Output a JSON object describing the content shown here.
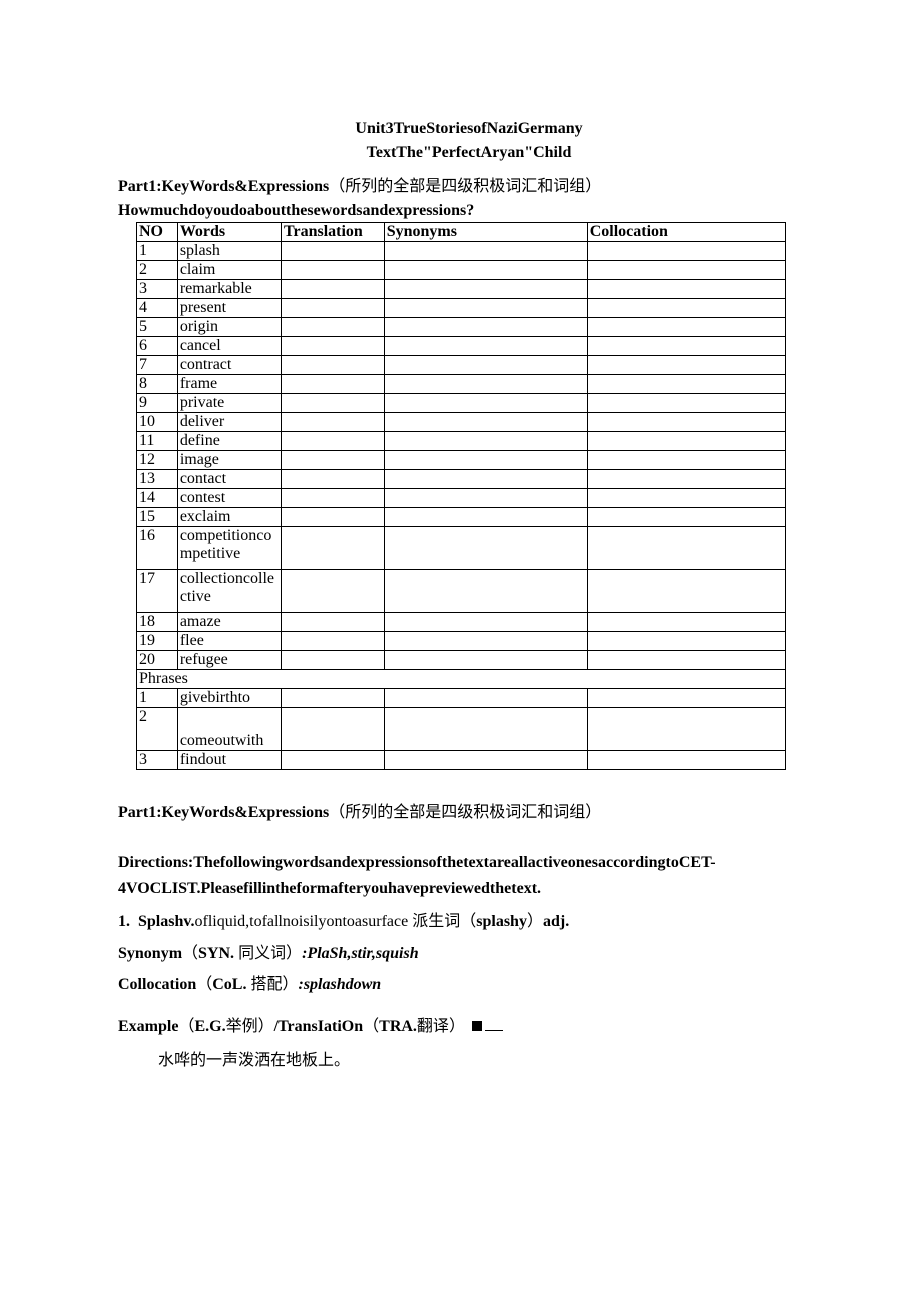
{
  "title_line1": "Unit3TrueStoriesofNaziGermany",
  "title_line2": "TextThe\"PerfectAryan\"Child",
  "part1_heading_bold": "Part1:KeyWords&Expressions",
  "part1_heading_note": "（所列的全部是四级积极词汇和词组）",
  "question": "Howmuchdoyoudoaboutthesewordsandexpressions?",
  "headers": {
    "no": "NO",
    "words": "Words",
    "translation": "Translation",
    "synonyms": "Synonyms",
    "collocation": "Collocation"
  },
  "rows": [
    {
      "no": "1",
      "word": "splash"
    },
    {
      "no": "2",
      "word": "claim"
    },
    {
      "no": "3",
      "word": "remarkable"
    },
    {
      "no": "4",
      "word": "present"
    },
    {
      "no": "5",
      "word": "origin"
    },
    {
      "no": "6",
      "word": "cancel"
    },
    {
      "no": "7",
      "word": "contract"
    },
    {
      "no": "8",
      "word": "frame"
    },
    {
      "no": "9",
      "word": "private"
    },
    {
      "no": "10",
      "word": "deliver"
    },
    {
      "no": "11",
      "word": "define"
    },
    {
      "no": "12",
      "word": "image"
    },
    {
      "no": "13",
      "word": "contact"
    },
    {
      "no": "14",
      "word": "contest"
    },
    {
      "no": "15",
      "word": "exclaim"
    },
    {
      "no": "16",
      "word": "competitioncompetitive"
    },
    {
      "no": "17",
      "word": "collectioncollective"
    },
    {
      "no": "18",
      "word": "amaze"
    },
    {
      "no": "19",
      "word": "flee"
    },
    {
      "no": "20",
      "word": "refugee"
    }
  ],
  "phrases_label": "Phrases",
  "phrase_rows": [
    {
      "no": "1",
      "word": "givebirthto"
    },
    {
      "no": "2",
      "word": "comeoutwith"
    },
    {
      "no": "3",
      "word": "findout"
    }
  ],
  "part1b_heading_bold": "Part1:KeyWords&Expressions",
  "part1b_heading_note": "（所列的全部是四级积极词汇和词组）",
  "directions": "Directions:ThefollowingwordsandexpressionsofthetextareallactiveonesaccordingtoCET-4VOCLIST.Pleasefillintheformafteryouhavepreviewedthetext.",
  "entry1": {
    "num": "1.",
    "head": "Splashv.",
    "def": "ofliquid,tofallnoisilyontoasurface",
    "deriv_label": "派生词",
    "deriv_paren_l": "（",
    "deriv_word": "splashy",
    "deriv_paren_r": "）",
    "deriv_pos": "adj."
  },
  "synonym": {
    "label_bold": "Synonym",
    "paren_l": "（",
    "abbr": "SYN.",
    "note": "同义词",
    "paren_r": "）",
    "body": ":PlaSh,stir,squish"
  },
  "collocation": {
    "label_bold": "Collocation",
    "paren_l": "（",
    "abbr": "CoL.",
    "note": "搭配",
    "paren_r": "）",
    "body": ":splashdown"
  },
  "example": {
    "label_bold": "Example",
    "paren_l": "（",
    "abbr": "E.G.",
    "note": "举例",
    "paren_r": "）",
    "slash": "/TransIatiOn",
    "paren_l2": "（",
    "abbr2": "TRA.",
    "note2": "翻译",
    "paren_r2": "）"
  },
  "chinese_sentence": "水哗的一声泼洒在地板上。"
}
